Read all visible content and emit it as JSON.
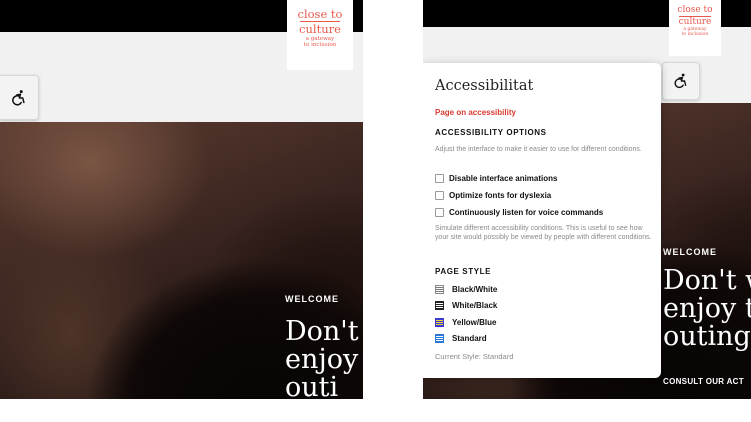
{
  "brand": {
    "line1": "close to",
    "line2": "culture",
    "line3": "a gateway",
    "line4": "to inclusion",
    "color": "#e8584c"
  },
  "left_frame": {
    "welcome": "WELCOME",
    "headline_lines": [
      "Don't",
      "enjoy",
      "outi"
    ]
  },
  "right_frame": {
    "welcome": "WELCOME",
    "headline_lines": [
      "Don't w",
      "enjoy th",
      "outing!"
    ],
    "cta": "CONSULT OUR ACT"
  },
  "panel": {
    "title": "Accessibilitat",
    "page_link": "Page on accessibility",
    "options_heading": "ACCESSIBILITY OPTIONS",
    "options_desc": "Adjust the interface to make it easier to use for different conditions.",
    "options": [
      {
        "label": "Disable interface animations",
        "checked": false
      },
      {
        "label": "Optimize fonts for dyslexia",
        "checked": false
      },
      {
        "label": "Continuously listen for voice commands",
        "checked": false
      }
    ],
    "simulate_desc": "Simulate different accessibility conditions. This is useful to see how your site would possibly be viewed by people with different conditions.",
    "style_heading": "PAGE STYLE",
    "styles": [
      {
        "label": "Black/White",
        "icon": "black-white-swatch-icon"
      },
      {
        "label": "White/Black",
        "icon": "white-black-swatch-icon"
      },
      {
        "label": "Yellow/Blue",
        "icon": "yellow-blue-swatch-icon"
      },
      {
        "label": "Standard",
        "icon": "standard-swatch-icon"
      }
    ],
    "current_style": "Current Style: Standard"
  },
  "colors": {
    "accent": "#d93a30",
    "topbar": "#000000"
  }
}
